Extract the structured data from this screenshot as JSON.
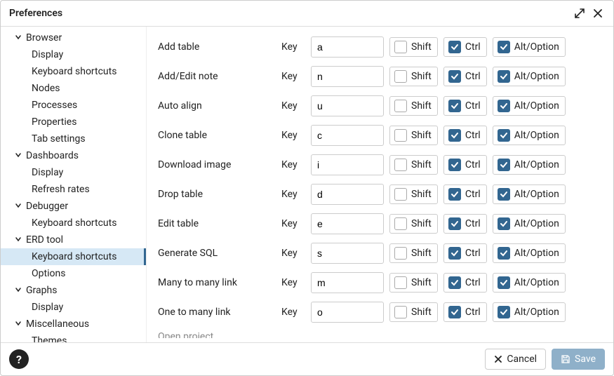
{
  "title": "Preferences",
  "sidebar": [
    {
      "label": "Browser",
      "items": [
        "Display",
        "Keyboard shortcuts",
        "Nodes",
        "Processes",
        "Properties",
        "Tab settings"
      ]
    },
    {
      "label": "Dashboards",
      "items": [
        "Display",
        "Refresh rates"
      ]
    },
    {
      "label": "Debugger",
      "items": [
        "Keyboard shortcuts"
      ]
    },
    {
      "label": "ERD tool",
      "items": [
        "Keyboard shortcuts",
        "Options"
      ],
      "selectedIndex": 0
    },
    {
      "label": "Graphs",
      "items": [
        "Display"
      ]
    },
    {
      "label": "Miscellaneous",
      "items": [
        "Themes"
      ]
    }
  ],
  "columns": {
    "key": "Key",
    "shift": "Shift",
    "ctrl": "Ctrl",
    "alt": "Alt/Option"
  },
  "shortcuts": [
    {
      "label": "Add table",
      "key": "a",
      "shift": false,
      "ctrl": true,
      "alt": true
    },
    {
      "label": "Add/Edit note",
      "key": "n",
      "shift": false,
      "ctrl": true,
      "alt": true
    },
    {
      "label": "Auto align",
      "key": "u",
      "shift": false,
      "ctrl": true,
      "alt": true
    },
    {
      "label": "Clone table",
      "key": "c",
      "shift": false,
      "ctrl": true,
      "alt": true
    },
    {
      "label": "Download image",
      "key": "i",
      "shift": false,
      "ctrl": true,
      "alt": true
    },
    {
      "label": "Drop table",
      "key": "d",
      "shift": false,
      "ctrl": true,
      "alt": true
    },
    {
      "label": "Edit table",
      "key": "e",
      "shift": false,
      "ctrl": true,
      "alt": true
    },
    {
      "label": "Generate SQL",
      "key": "s",
      "shift": false,
      "ctrl": true,
      "alt": true
    },
    {
      "label": "Many to many link",
      "key": "m",
      "shift": false,
      "ctrl": true,
      "alt": true
    },
    {
      "label": "One to many link",
      "key": "o",
      "shift": false,
      "ctrl": true,
      "alt": true
    }
  ],
  "partial_next_label": "Open project",
  "footer": {
    "cancel": "Cancel",
    "save": "Save"
  }
}
